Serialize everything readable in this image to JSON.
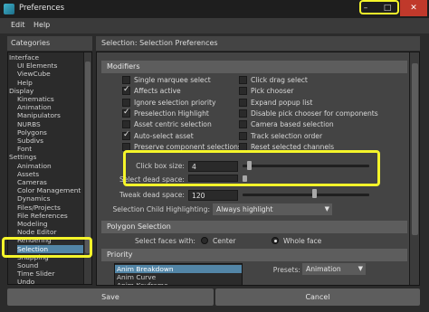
{
  "window": {
    "title": "Preferences",
    "minimize": "–",
    "maximize": "□",
    "close": "✕"
  },
  "menu": [
    "Edit",
    "Help"
  ],
  "categories": {
    "header": "Categories",
    "items": [
      {
        "label": "Interface",
        "indent": 0
      },
      {
        "label": "UI Elements",
        "indent": 1
      },
      {
        "label": "ViewCube",
        "indent": 1
      },
      {
        "label": "Help",
        "indent": 1
      },
      {
        "label": "Display",
        "indent": 0
      },
      {
        "label": "Kinematics",
        "indent": 1
      },
      {
        "label": "Animation",
        "indent": 1
      },
      {
        "label": "Manipulators",
        "indent": 1
      },
      {
        "label": "NURBS",
        "indent": 1
      },
      {
        "label": "Polygons",
        "indent": 1
      },
      {
        "label": "Subdivs",
        "indent": 1
      },
      {
        "label": "Font",
        "indent": 1
      },
      {
        "label": "Settings",
        "indent": 0
      },
      {
        "label": "Animation",
        "indent": 1
      },
      {
        "label": "Assets",
        "indent": 1
      },
      {
        "label": "Cameras",
        "indent": 1
      },
      {
        "label": "Color Management",
        "indent": 1
      },
      {
        "label": "Dynamics",
        "indent": 1
      },
      {
        "label": "Files/Projects",
        "indent": 1
      },
      {
        "label": "File References",
        "indent": 1
      },
      {
        "label": "Modeling",
        "indent": 1
      },
      {
        "label": "Node Editor",
        "indent": 1
      },
      {
        "label": "Rendering",
        "indent": 1
      },
      {
        "label": "Selection",
        "indent": 1,
        "selected": true
      },
      {
        "label": "Snapping",
        "indent": 1
      },
      {
        "label": "Sound",
        "indent": 1
      },
      {
        "label": "Time Slider",
        "indent": 1
      },
      {
        "label": "Undo",
        "indent": 1
      }
    ]
  },
  "panel_title": "Selection: Selection Preferences",
  "modifiers": {
    "header": "Modifiers",
    "left": [
      {
        "label": "Single marquee select",
        "checked": false
      },
      {
        "label": "Affects active",
        "checked": true
      },
      {
        "label": "Ignore selection priority",
        "checked": false
      },
      {
        "label": "Preselection Highlight",
        "checked": true
      },
      {
        "label": "Asset centric selection",
        "checked": false
      },
      {
        "label": "Auto-select asset",
        "checked": true
      },
      {
        "label": "Preserve component selections",
        "checked": false
      }
    ],
    "right": [
      {
        "label": "Click drag select",
        "checked": false
      },
      {
        "label": "Pick chooser",
        "checked": false
      },
      {
        "label": "Expand popup list",
        "checked": false
      },
      {
        "label": "Disable pick chooser for components",
        "checked": false
      },
      {
        "label": "Camera based selection",
        "checked": false
      },
      {
        "label": "Track selection order",
        "checked": false
      },
      {
        "label": "Reset selected channels",
        "checked": false
      }
    ],
    "click_box_size": {
      "label": "Click box size:",
      "value": "4",
      "slider_fraction": 0.02
    },
    "select_dead_space": {
      "label": "Select dead space:",
      "value": "",
      "slider_fraction": 0.0
    },
    "tweak_dead_space": {
      "label": "Tweak dead space:",
      "value": "120",
      "slider_fraction": 0.48
    },
    "child_highlighting": {
      "label": "Selection Child Highlighting:",
      "value": "Always highlight"
    }
  },
  "polygon_selection": {
    "header": "Polygon Selection",
    "label": "Select faces with:",
    "options": [
      {
        "label": "Center",
        "selected": false
      },
      {
        "label": "Whole face",
        "selected": true
      }
    ]
  },
  "priority": {
    "header": "Priority",
    "items": [
      {
        "label": "Anim Breakdown",
        "selected": true
      },
      {
        "label": "Anim Curve",
        "selected": false
      },
      {
        "label": "Anim Keyframe",
        "selected": false
      }
    ],
    "presets_label": "Presets:",
    "presets_value": "Animation"
  },
  "buttons": {
    "save": "Save",
    "cancel": "Cancel"
  },
  "colors": {
    "highlight": "#f5f52a",
    "selection": "#5285a6"
  }
}
